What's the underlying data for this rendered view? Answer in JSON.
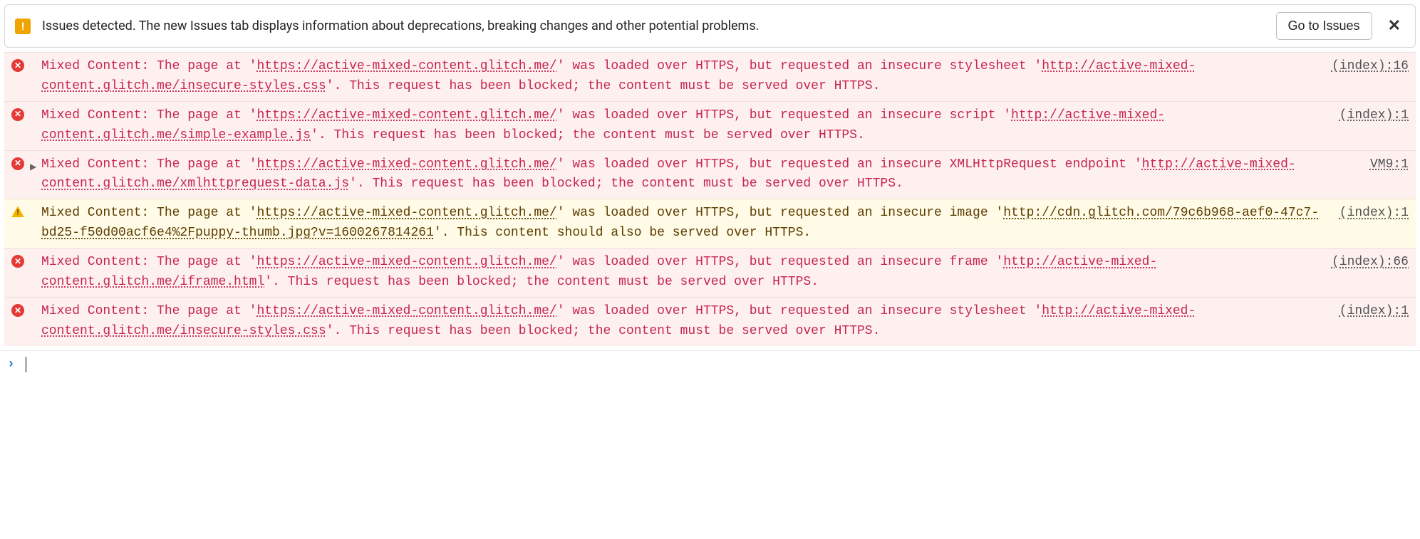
{
  "issues_banner": {
    "icon_glyph": "!",
    "text": "Issues detected. The new Issues tab displays information about deprecations, breaking changes and other potential problems.",
    "button_label": "Go to Issues",
    "close_glyph": "✕"
  },
  "console_rows": [
    {
      "type": "error",
      "expandable": false,
      "source": "(index):16",
      "segments": [
        {
          "t": "Mixed Content: The page at '"
        },
        {
          "t": "https://active-mixed-content.glitch.me/",
          "link": true
        },
        {
          "t": "' was loaded over HTTPS, but requested an insecure stylesheet '"
        },
        {
          "t": "http://active-mixed-content.glitch.me/insecure-styles.css",
          "link": true
        },
        {
          "t": "'. This request has been blocked; the content must be served over HTTPS."
        }
      ]
    },
    {
      "type": "error",
      "expandable": false,
      "source": "(index):1",
      "segments": [
        {
          "t": "Mixed Content: The page at '"
        },
        {
          "t": "https://active-mixed-content.glitch.me/",
          "link": true
        },
        {
          "t": "' was loaded over HTTPS, but requested an insecure script '"
        },
        {
          "t": "http://active-mixed-content.glitch.me/simple-example.js",
          "link": true
        },
        {
          "t": "'. This request has been blocked; the content must be served over HTTPS."
        }
      ]
    },
    {
      "type": "error",
      "expandable": true,
      "source": "VM9:1",
      "segments": [
        {
          "t": "Mixed Content: The page at '"
        },
        {
          "t": "https://active-mixed-content.glitch.me/",
          "link": true
        },
        {
          "t": "' was loaded over HTTPS, but requested an insecure XMLHttpRequest endpoint '"
        },
        {
          "t": "http://active-mixed-content.glitch.me/xmlhttprequest-data.js",
          "link": true
        },
        {
          "t": "'. This request has been blocked; the content must be served over HTTPS."
        }
      ]
    },
    {
      "type": "warn",
      "expandable": false,
      "source": "(index):1",
      "segments": [
        {
          "t": "Mixed Content: The page at '"
        },
        {
          "t": "https://active-mixed-content.glitch.me/",
          "link": true
        },
        {
          "t": "' was loaded over HTTPS, but requested an insecure image '"
        },
        {
          "t": "http://cdn.glitch.com/79c6b968-aef0-47c7-bd25-f50d00acf6e4%2Fpuppy-thumb.jpg?v=1600267814261",
          "link": true
        },
        {
          "t": "'. This content should also be served over HTTPS."
        }
      ]
    },
    {
      "type": "error",
      "expandable": false,
      "source": "(index):66",
      "segments": [
        {
          "t": "Mixed Content: The page at '"
        },
        {
          "t": "https://active-mixed-content.glitch.me/",
          "link": true
        },
        {
          "t": "' was loaded over HTTPS, but requested an insecure frame '"
        },
        {
          "t": "http://active-mixed-content.glitch.me/iframe.html",
          "link": true
        },
        {
          "t": "'. This request has been blocked; the content must be served over HTTPS."
        }
      ]
    },
    {
      "type": "error",
      "expandable": false,
      "source": "(index):1",
      "segments": [
        {
          "t": "Mixed Content: The page at '"
        },
        {
          "t": "https://active-mixed-content.glitch.me/",
          "link": true
        },
        {
          "t": "' was loaded over HTTPS, but requested an insecure stylesheet '"
        },
        {
          "t": "http://active-mixed-content.glitch.me/insecure-styles.css",
          "link": true
        },
        {
          "t": "'. This request has been blocked; the content must be served over HTTPS."
        }
      ]
    }
  ],
  "prompt": {
    "chevron": "›",
    "value": ""
  }
}
